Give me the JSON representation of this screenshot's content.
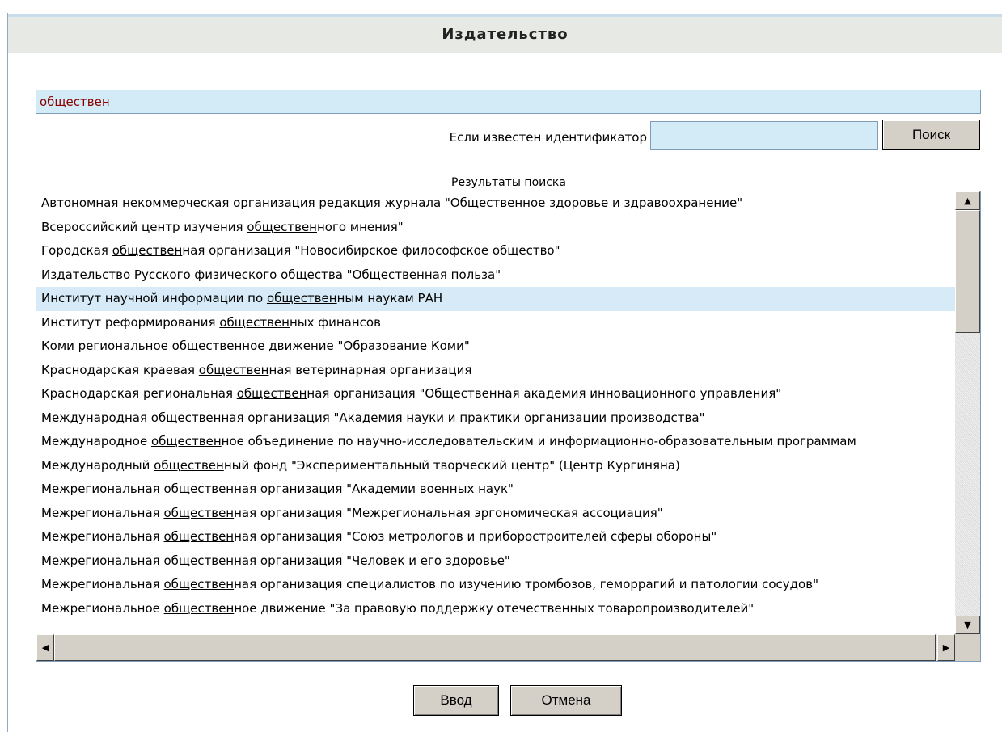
{
  "dialog": {
    "title": "Издательство"
  },
  "search": {
    "value": "обществен"
  },
  "identifier": {
    "label": "Если известен идентификатор",
    "value": "",
    "search_button": "Поиск"
  },
  "results": {
    "caption": "Результаты поиска",
    "selected_index": 4,
    "items": [
      [
        "Автономная некоммерческая организация редакция журнала \"",
        "Обществен",
        "ное здоровье и здравоохранение\""
      ],
      [
        "Всероссийский центр изучения ",
        "обществен",
        "ного мнения\""
      ],
      [
        "Городская ",
        "обществен",
        "ная организация \"Новосибирское философское общество\""
      ],
      [
        "Издательство Русского физического общества \"",
        "Обществен",
        "ная польза\""
      ],
      [
        "Институт научной информации по ",
        "обществен",
        "ным наукам РАН"
      ],
      [
        "Институт реформирования ",
        "обществен",
        "ных финансов"
      ],
      [
        "Коми региональное ",
        "обществен",
        "ное движение \"Образование Коми\""
      ],
      [
        "Краснодарская краевая ",
        "обществен",
        "ная ветеринарная организация"
      ],
      [
        "Краснодарская региональная ",
        "обществен",
        "ная организация \"Общественная академия инновационного управления\""
      ],
      [
        "Международная ",
        "обществен",
        "ная организация \"Академия науки и практики организации производства\""
      ],
      [
        "Международное ",
        "обществен",
        "ное объединение по научно-исследовательским и информационно-образовательным программам"
      ],
      [
        "Международный ",
        "обществен",
        "ный фонд \"Экспериментальный творческий центр\" (Центр Кургиняна)"
      ],
      [
        "Межрегиональная ",
        "обществен",
        "ная организация \"Академии военных наук\""
      ],
      [
        "Межрегиональная ",
        "обществен",
        "ная организация \"Межрегиональная эргономическая ассоциация\""
      ],
      [
        "Межрегиональная ",
        "обществен",
        "ная организация \"Союз метрологов и приборостроителей сферы обороны\""
      ],
      [
        "Межрегиональная ",
        "обществен",
        "ная организация \"Человек и его здоровье\""
      ],
      [
        "Межрегиональная ",
        "обществен",
        "ная организация специалистов по изучению тромбозов, геморрагий и патологии сосудов\""
      ],
      [
        "Межрегиональное ",
        "обществен",
        "ное движение \"За правовую поддержку отечественных товаропроизводителей\""
      ]
    ]
  },
  "scroll": {
    "vertical_position": 0.0,
    "horizontal_position": 0.0
  },
  "buttons": {
    "ok": "Ввод",
    "cancel": "Отмена"
  },
  "colors": {
    "selected_row": "#d6ebf7",
    "input_bg": "#d3eaf7",
    "search_text": "#8b0000"
  }
}
